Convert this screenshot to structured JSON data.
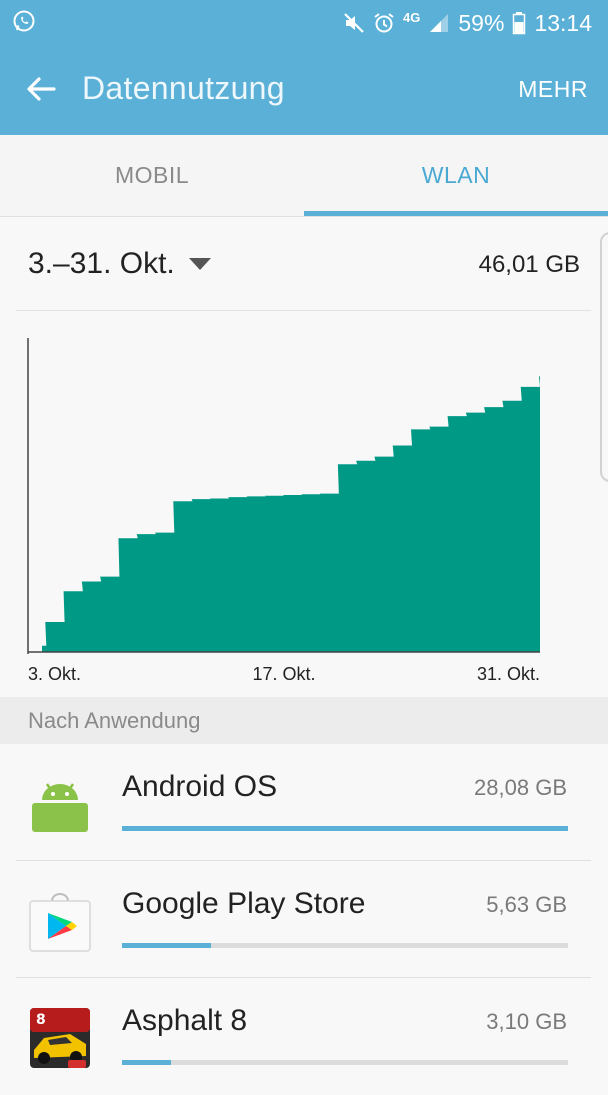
{
  "status_bar": {
    "icons": [
      "whatsapp-icon",
      "mute-icon",
      "alarm-icon",
      "4g-icon",
      "signal-icon",
      "battery-icon"
    ],
    "network": "4G",
    "battery": "59%",
    "time": "13:14"
  },
  "app_bar": {
    "title": "Datennutzung",
    "more_label": "MEHR",
    "back_icon": "arrow-back-icon"
  },
  "tabs": [
    {
      "label": "MOBIL",
      "selected": false
    },
    {
      "label": "WLAN",
      "selected": true
    }
  ],
  "range": {
    "label": "3.–31. Okt.",
    "total": "46,01 GB"
  },
  "chart_data": {
    "type": "area",
    "color": "#009985",
    "unit": "GB",
    "x_tick_labels": [
      "3. Okt.",
      "17. Okt.",
      "31. Okt."
    ],
    "x": [
      3,
      4,
      5,
      6,
      7,
      8,
      9,
      10,
      11,
      12,
      13,
      14,
      15,
      16,
      17,
      18,
      19,
      20,
      21,
      22,
      23,
      24,
      25,
      26,
      27,
      28,
      29,
      30,
      31
    ],
    "values": [
      0.9,
      4.3,
      8.7,
      10.1,
      10.8,
      16.3,
      16.9,
      17.1,
      21.6,
      21.9,
      22.0,
      22.2,
      22.3,
      22.4,
      22.5,
      22.6,
      22.7,
      26.9,
      27.4,
      28.0,
      29.6,
      31.9,
      32.3,
      33.8,
      34.3,
      35.1,
      36.0,
      38.0,
      39.5
    ]
  },
  "section": {
    "title": "Nach Anwendung"
  },
  "apps": [
    {
      "name": "Android OS",
      "size": "28,08 GB",
      "icon": "android-icon",
      "fraction": 1.0
    },
    {
      "name": "Google Play Store",
      "size": "5,63 GB",
      "icon": "play-store-icon",
      "fraction": 0.2
    },
    {
      "name": "Asphalt 8",
      "size": "3,10 GB",
      "icon": "asphalt-8-icon",
      "fraction": 0.11
    }
  ],
  "colors": {
    "header": "#5ab0d7",
    "accent": "#4aa9d3",
    "chart": "#009985"
  }
}
